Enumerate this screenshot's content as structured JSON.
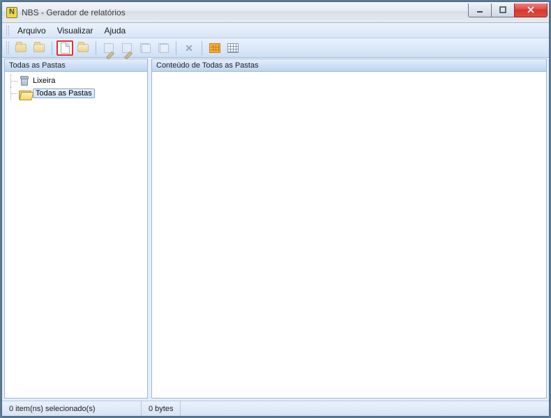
{
  "window": {
    "title": "NBS - Gerador de relatórios"
  },
  "menu": {
    "items": [
      "Arquivo",
      "Visualizar",
      "Ajuda"
    ]
  },
  "toolbar": {
    "groups": [
      [
        {
          "name": "new-folder-icon",
          "type": "folder"
        },
        {
          "name": "open-folder-icon",
          "type": "folder-open"
        }
      ],
      [
        {
          "name": "new-document-icon",
          "type": "doc",
          "selected": true
        },
        {
          "name": "open-document-icon",
          "type": "folder-open"
        }
      ],
      [
        {
          "name": "edit-icon",
          "type": "edit"
        },
        {
          "name": "rename-icon",
          "type": "edit"
        },
        {
          "name": "copy-icon",
          "type": "dup"
        },
        {
          "name": "duplicate-icon",
          "type": "dup"
        }
      ],
      [
        {
          "name": "delete-icon",
          "type": "x"
        }
      ],
      [
        {
          "name": "large-icons-view-icon",
          "type": "grid-large",
          "active": true
        },
        {
          "name": "details-view-icon",
          "type": "grid-details",
          "active": true
        }
      ]
    ]
  },
  "left_pane": {
    "header": "Todas as Pastas",
    "nodes": [
      {
        "icon": "trash",
        "label": "Lixeira",
        "selected": false
      },
      {
        "icon": "folder-open",
        "label": "Todas as Pastas",
        "selected": true
      }
    ]
  },
  "right_pane": {
    "header": "Conteúdo de Todas as Pastas"
  },
  "statusbar": {
    "selection": "0 item(ns) selecionado(s)",
    "size": "0 bytes"
  }
}
